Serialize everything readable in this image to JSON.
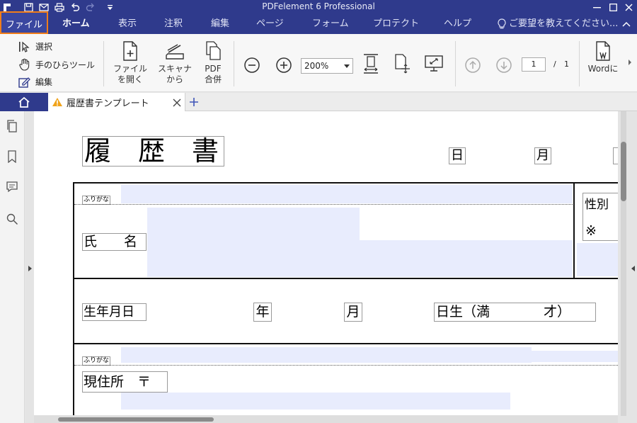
{
  "app": {
    "title": "PDFelement 6 Professional"
  },
  "quick_access": [
    "app-logo-icon",
    "save-icon",
    "mail-icon",
    "print-icon",
    "undo-icon",
    "redo-icon",
    "customize-icon"
  ],
  "menu": {
    "file": "ファイル",
    "items": [
      "ホーム",
      "表示",
      "注釈",
      "編集",
      "ページ",
      "フォーム",
      "プロテクト",
      "ヘルプ"
    ],
    "active": "ホーム",
    "feedback": "ご要望を教えてください..."
  },
  "ribbon": {
    "select": "選択",
    "hand": "手のひらツール",
    "edit": "編集",
    "open_file_line1": "ファイル",
    "open_file_line2": "を開く",
    "scanner_line1": "スキャナ",
    "scanner_line2": "から",
    "merge_line1": "PDF",
    "merge_line2": "合併",
    "zoom": "200%",
    "page_current": "1",
    "page_sep": "/",
    "page_total": "1",
    "to_word": "Wordに"
  },
  "tabs": {
    "doc_title": "履歴書テンプレート"
  },
  "document": {
    "title": "履　歴　書",
    "day_label": "日",
    "month_label": "月",
    "furigana": "ふりがな",
    "name_label": "氏　　名",
    "gender_label": "性別",
    "note_mark": "※",
    "birth_label": "生年月日",
    "year_label": "年",
    "month2_label": "月",
    "age_label": "日生（満　　　　才）",
    "furigana2": "ふりがな",
    "address_label": "現住所　〒"
  },
  "colors": {
    "titlebar": "#2f3a8c",
    "highlight": "#f07d1a",
    "fill": "#e8ecfd"
  }
}
